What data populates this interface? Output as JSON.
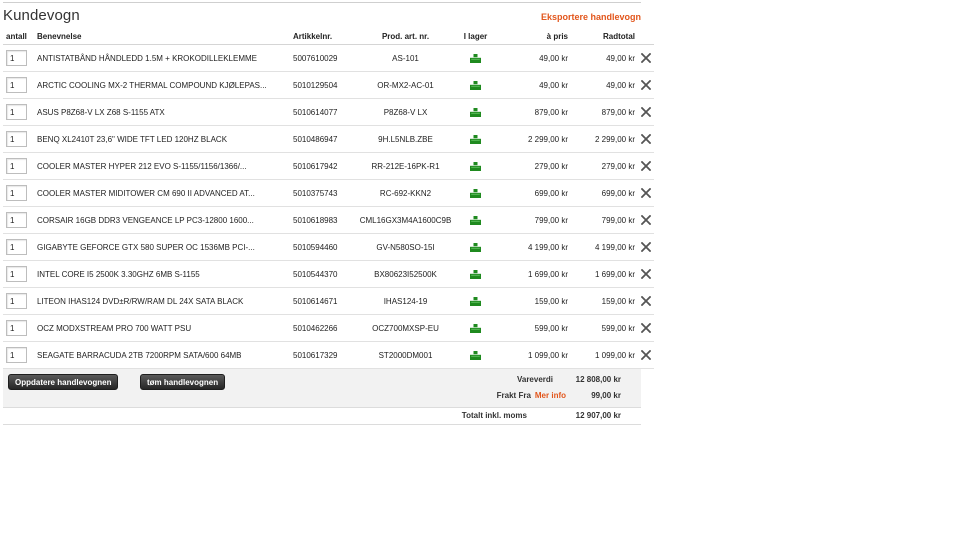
{
  "cart": {
    "title": "Kundevogn",
    "export_label": "Eksportere handlevogn",
    "columns": {
      "qty": "antall",
      "name": "Benevnelse",
      "article": "Artikkelnr.",
      "prod": "Prod. art. nr.",
      "stock": "I lager",
      "price": "à pris",
      "total": "Radtotal"
    },
    "items": [
      {
        "qty": "1",
        "name": "ANTISTATBÅND HÅNDLEDD 1.5M + KROKODILLEKLEMME",
        "article": "5007610029",
        "prod": "AS-101",
        "price": "49,00 kr",
        "total": "49,00 kr"
      },
      {
        "qty": "1",
        "name": "ARCTIC COOLING MX-2 THERMAL COMPOUND KJØLEPAS...",
        "article": "5010129504",
        "prod": "OR-MX2-AC-01",
        "price": "49,00 kr",
        "total": "49,00 kr"
      },
      {
        "qty": "1",
        "name": "ASUS P8Z68-V LX Z68 S-1155 ATX",
        "article": "5010614077",
        "prod": "P8Z68-V LX",
        "price": "879,00 kr",
        "total": "879,00 kr"
      },
      {
        "qty": "1",
        "name": "BENQ XL2410T 23,6\" WIDE TFT LED 120HZ BLACK",
        "article": "5010486947",
        "prod": "9H.L5NLB.ZBE",
        "price": "2 299,00 kr",
        "total": "2 299,00 kr"
      },
      {
        "qty": "1",
        "name": "COOLER MASTER HYPER 212 EVO S-1155/1156/1366/...",
        "article": "5010617942",
        "prod": "RR-212E-16PK-R1",
        "price": "279,00 kr",
        "total": "279,00 kr"
      },
      {
        "qty": "1",
        "name": "COOLER MASTER MIDITOWER CM 690 II ADVANCED AT...",
        "article": "5010375743",
        "prod": "RC-692-KKN2",
        "price": "699,00 kr",
        "total": "699,00 kr"
      },
      {
        "qty": "1",
        "name": "CORSAIR 16GB DDR3 VENGEANCE LP PC3-12800 1600...",
        "article": "5010618983",
        "prod": "CML16GX3M4A1600C9B",
        "price": "799,00 kr",
        "total": "799,00 kr"
      },
      {
        "qty": "1",
        "name": "GIGABYTE GEFORCE GTX 580 SUPER OC 1536MB PCI-...",
        "article": "5010594460",
        "prod": "GV-N580SO-15I",
        "price": "4 199,00 kr",
        "total": "4 199,00 kr"
      },
      {
        "qty": "1",
        "name": "INTEL CORE I5 2500K 3.30GHZ 6MB S-1155",
        "article": "5010544370",
        "prod": "BX80623I52500K",
        "price": "1 699,00 kr",
        "total": "1 699,00 kr"
      },
      {
        "qty": "1",
        "name": "LITEON IHAS124 DVD±R/RW/RAM DL 24X SATA BLACK",
        "article": "5010614671",
        "prod": "IHAS124-19",
        "price": "159,00 kr",
        "total": "159,00 kr"
      },
      {
        "qty": "1",
        "name": "OCZ MODXSTREAM PRO 700 WATT PSU",
        "article": "5010462266",
        "prod": "OCZ700MXSP-EU",
        "price": "599,00 kr",
        "total": "599,00 kr"
      },
      {
        "qty": "1",
        "name": "SEAGATE BARRACUDA 2TB 7200RPM SATA/600 64MB",
        "article": "5010617329",
        "prod": "ST2000DM001",
        "price": "1 099,00 kr",
        "total": "1 099,00 kr"
      }
    ],
    "update_button": "Oppdatere handlevognen",
    "empty_button": "tøm handlevognen",
    "summary": {
      "goods_label": "Vareverdi",
      "goods_value": "12 808,00 kr",
      "freight_label": "Frakt Fra",
      "more_info": "Mer info",
      "freight_value": "99,00 kr",
      "total_label": "Totalt inkl. moms",
      "total_value": "12 907,00 kr"
    },
    "colors": {
      "accent": "#e2561c",
      "stock_green": "#1f8a1f",
      "button_dark": "#333333"
    },
    "icons": {
      "stock": "in-stock-icon",
      "delete": "close-icon"
    }
  }
}
